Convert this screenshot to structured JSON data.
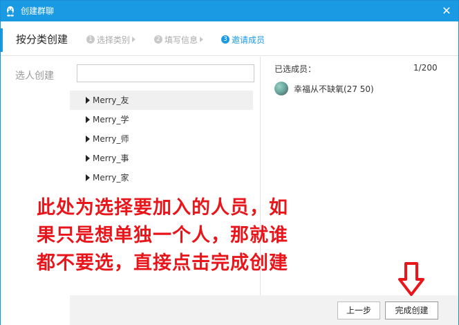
{
  "window": {
    "title": "创建群聊",
    "close_glyph": "✕"
  },
  "header": {
    "page_title": "按分类创建",
    "steps": [
      {
        "num": "1",
        "label": "选择类别",
        "active": false
      },
      {
        "num": "2",
        "label": "填写信息",
        "active": false
      },
      {
        "num": "3",
        "label": "邀请成员",
        "active": true
      }
    ]
  },
  "left": {
    "select_label": "选人创建"
  },
  "search": {
    "value": "",
    "placeholder": ""
  },
  "groups": [
    {
      "label": "Merry_友",
      "selected": true
    },
    {
      "label": "Merry_学",
      "selected": false
    },
    {
      "label": "Merry_师",
      "selected": false
    },
    {
      "label": "Merry_事",
      "selected": false
    },
    {
      "label": "Merry_家",
      "selected": false
    }
  ],
  "selected_panel": {
    "title": "已选成员：",
    "count": "1/200",
    "members": [
      {
        "name": "幸福从不缺氧(27          50)"
      }
    ]
  },
  "footer": {
    "prev_label": "上一步",
    "finish_label": "完成创建"
  },
  "annotation": {
    "lines": [
      "此处为选择要加入的人员，如",
      "果只是想单独一个人，那就谁",
      "都不要选，直接点击完成创建"
    ]
  },
  "colors": {
    "title_bar": "#1b9ae4",
    "accent": "#1b9ae4",
    "annotation": "#e8161b"
  },
  "icons": {
    "app": "qq-penguin-icon",
    "close": "close-icon",
    "expand": "triangle-right-icon",
    "pointer": "down-arrow-icon"
  }
}
